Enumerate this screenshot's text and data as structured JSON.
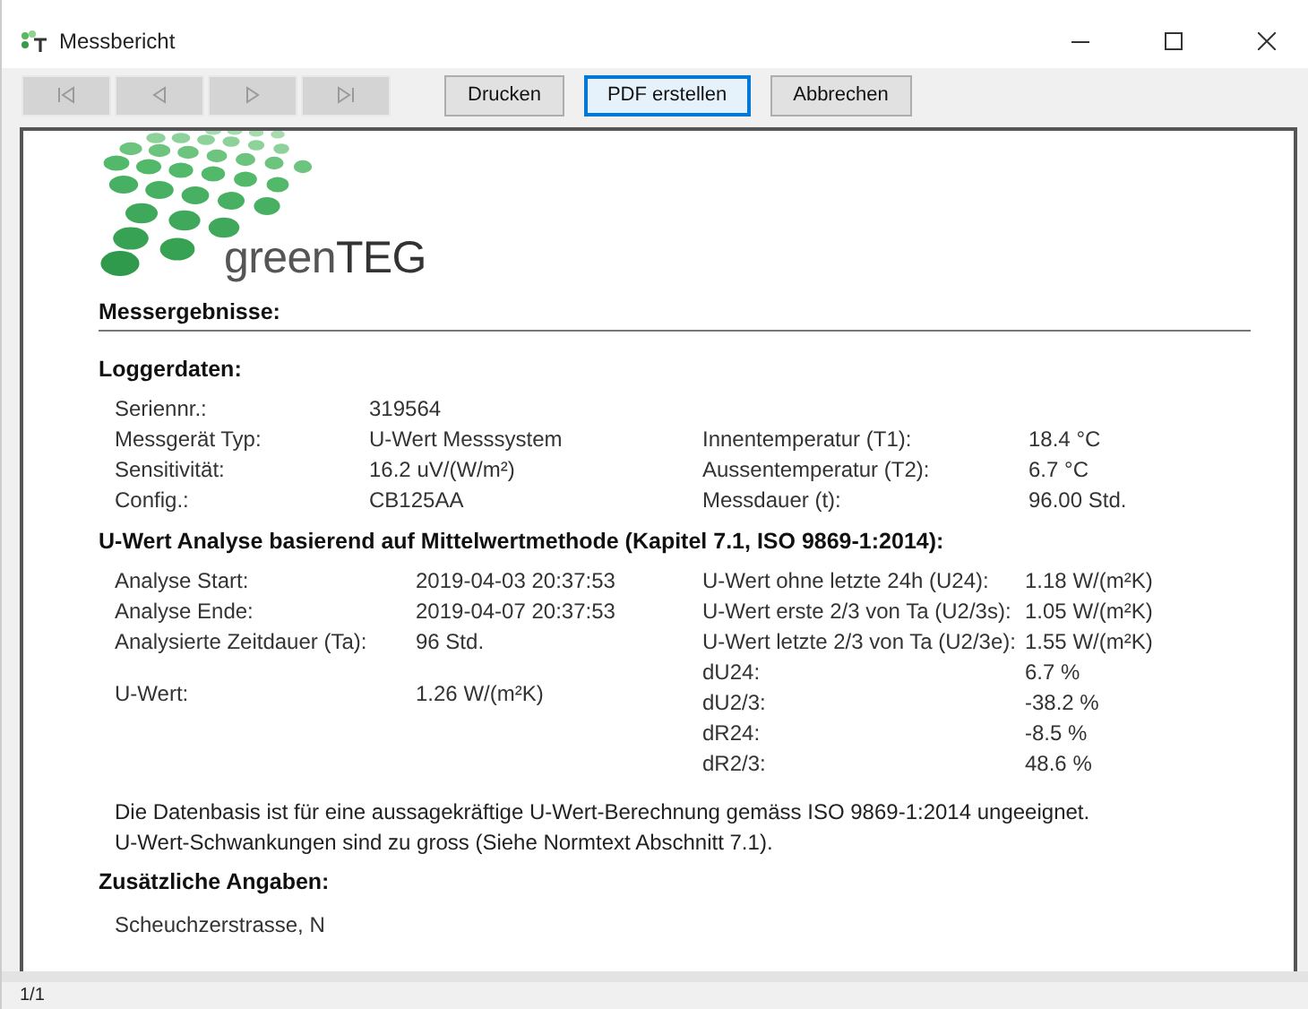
{
  "window": {
    "title": "Messbericht"
  },
  "toolbar": {
    "nav_buttons": [
      {
        "kind": "first",
        "disabled": true
      },
      {
        "kind": "prev",
        "disabled": true
      },
      {
        "kind": "next",
        "disabled": true
      },
      {
        "kind": "last",
        "disabled": true
      }
    ],
    "buttons": [
      {
        "label": "Drucken",
        "focused": false
      },
      {
        "label": "PDF erstellen",
        "focused": true
      },
      {
        "label": "Abbrechen",
        "focused": false
      }
    ]
  },
  "report": {
    "logo_text": "green**TEG**",
    "title": "Messergebnisse:",
    "logger": {
      "heading": "Loggerdaten:",
      "rows": [
        {
          "label": "Seriennr.:",
          "value": "319564"
        },
        {
          "label": "Messgerät Typ:",
          "value": "U-Wert Messsystem",
          "label_2": "Innentemperatur (T1):",
          "value_2": "18.4 °C"
        },
        {
          "label": "Sensitivität:",
          "value": "16.2 uV/(W/m²)",
          "label_2": "Aussentemperatur (T2):",
          "value_2": "6.7 °C"
        },
        {
          "label": "Config.:",
          "value": "CB125AA",
          "label_2": "Messdauer (t):",
          "value_2": "96.00 Std."
        }
      ]
    },
    "analysis": {
      "heading": "U-Wert Analyse basierend auf Mittelwertmethode (Kapitel 7.1, ISO 9869-1:2014):",
      "left": [
        {
          "kind": "info",
          "label": "Analyse Start:",
          "value": "2019-04-03 20:37:53"
        },
        {
          "kind": "info",
          "label": "Analyse Ende:",
          "value": "2019-04-07 20:37:53"
        },
        {
          "kind": "info",
          "label": "Analysierte Zeitdauer (Ta):",
          "value": "96 Std."
        },
        {
          "kind": "result",
          "label": "U-Wert:",
          "value": "1.26 W/(m²K)"
        }
      ],
      "right": [
        {
          "label": "U-Wert ohne letzte 24h (U24):",
          "value": "1.18 W/(m²K)"
        },
        {
          "label": "U-Wert erste 2/3 von Ta (U2/3s):",
          "value": "1.05 W/(m²K)"
        },
        {
          "label": "U-Wert letzte 2/3 von Ta (U2/3e):",
          "value": "1.55 W/(m²K)"
        },
        {
          "label": "dU24:",
          "value": "6.7 %"
        },
        {
          "label": "dU2/3:",
          "value": "-38.2 %"
        },
        {
          "label": "dR24:",
          "value": "-8.5 %"
        },
        {
          "label": "dR2/3:",
          "value": "48.6 %"
        }
      ],
      "note_lines": [
        "Die Datenbasis ist für eine aussagekräftige U-Wert-Berechnung gemäss ISO 9869-1:2014 ungeeignet.",
        "U-Wert-Schwankungen sind zu gross (Siehe Normtext Abschnitt 7.1)."
      ]
    },
    "additional": {
      "heading": "Zusätzliche Angaben:",
      "text": "Scheuchzerstrasse, N"
    }
  },
  "status_bar": {
    "page": "1/1"
  }
}
